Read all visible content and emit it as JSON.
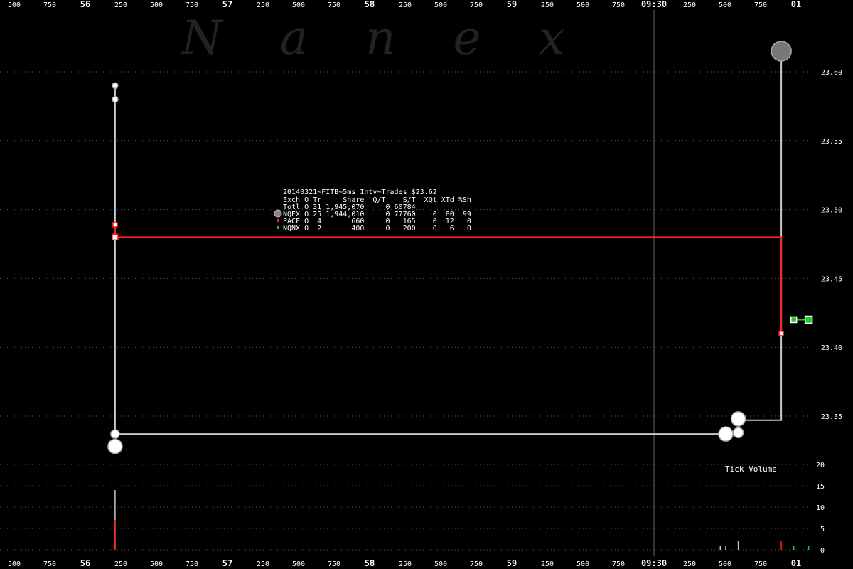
{
  "watermark": "N a n e x",
  "info_box": {
    "title": "20140321~FITB~5ms Intv~Trades $23.62",
    "header": "Exch O Tr     Share  Q/T    S/T  XQt XTd %Sh",
    "rows": [
      {
        "marker": "none",
        "text": "Totl O 31 1,945,070     0 60784"
      },
      {
        "marker": "gray",
        "text": "NQEX O 25 1,944,010     0 77760    0  80  99"
      },
      {
        "marker": "red",
        "text": "PACF O  4       660     0   165    0  12   0"
      },
      {
        "marker": "green",
        "text": "NQNX O  2       400     0   200    0   6   0"
      }
    ]
  },
  "volume_label": "Tick Volume",
  "colors": {
    "background": "#000000",
    "grid": "#5a5a5a",
    "nqex": "#c8c8c8",
    "pacf": "#ff2020",
    "nqnx": "#22cc22",
    "axis_text": "#ffffff"
  },
  "chart_data": {
    "type": "scatter",
    "x_tick_labels": [
      "500",
      "750",
      "56",
      "250",
      "500",
      "750",
      "57",
      "250",
      "500",
      "750",
      "58",
      "250",
      "500",
      "750",
      "59",
      "250",
      "500",
      "750",
      "09:30",
      "250",
      "500",
      "750",
      "01"
    ],
    "bold_x_labels": [
      "56",
      "57",
      "58",
      "59",
      "09:30",
      "01"
    ],
    "y_labels": [
      "23.60",
      "23.55",
      "23.50",
      "23.45",
      "23.40",
      "23.35"
    ],
    "y_values": [
      23.6,
      23.55,
      23.5,
      23.45,
      23.4,
      23.35
    ],
    "ylim": [
      23.315,
      23.625
    ],
    "volume_labels": [
      "20",
      "15",
      "10",
      "5",
      "0"
    ],
    "volume_values": [
      20,
      15,
      10,
      5,
      0
    ],
    "volume_ylim": [
      0,
      20
    ],
    "series": [
      {
        "name": "NQEX",
        "color": "#c8c8c8",
        "line": [
          [
            0.129,
            23.59
          ],
          [
            0.129,
            23.337
          ],
          [
            0.926,
            23.337
          ],
          [
            0.926,
            23.347
          ],
          [
            0.981,
            23.347
          ],
          [
            0.981,
            23.615
          ]
        ],
        "points": [
          {
            "x": 0.129,
            "y": 23.59,
            "r": 4
          },
          {
            "x": 0.129,
            "y": 23.58,
            "r": 4
          },
          {
            "x": 0.129,
            "y": 23.337,
            "r": 6
          },
          {
            "x": 0.129,
            "y": 23.328,
            "r": 10
          },
          {
            "x": 0.91,
            "y": 23.337,
            "r": 10
          },
          {
            "x": 0.926,
            "y": 23.338,
            "r": 7
          },
          {
            "x": 0.926,
            "y": 23.348,
            "r": 10
          },
          {
            "x": 0.981,
            "y": 23.615,
            "r": 14
          }
        ]
      },
      {
        "name": "PACF",
        "color": "#ff2020",
        "line": [
          [
            0.129,
            23.489
          ],
          [
            0.129,
            23.48
          ],
          [
            0.981,
            23.48
          ],
          [
            0.981,
            23.41
          ]
        ],
        "points": [
          {
            "x": 0.129,
            "y": 23.489,
            "r": 3
          },
          {
            "x": 0.129,
            "y": 23.48,
            "r": 4
          },
          {
            "x": 0.981,
            "y": 23.41,
            "r": 3
          }
        ]
      },
      {
        "name": "NQNX",
        "color": "#22cc22",
        "line": [
          [
            0.997,
            23.42
          ],
          [
            1.016,
            23.42
          ]
        ],
        "points": [
          {
            "x": 0.997,
            "y": 23.42,
            "r": 4
          },
          {
            "x": 1.016,
            "y": 23.42,
            "r": 5
          }
        ]
      }
    ],
    "volume_bars": [
      {
        "x": 0.129,
        "value": 14,
        "color": "#c8c8c8"
      },
      {
        "x": 0.129,
        "value": 7,
        "color": "#ff2020"
      },
      {
        "x": 0.903,
        "value": 1,
        "color": "#c8c8c8"
      },
      {
        "x": 0.91,
        "value": 1,
        "color": "#c8c8c8"
      },
      {
        "x": 0.926,
        "value": 2,
        "color": "#c8c8c8"
      },
      {
        "x": 0.981,
        "value": 2,
        "color": "#ff2020"
      },
      {
        "x": 0.997,
        "value": 1,
        "color": "#22cc22"
      },
      {
        "x": 1.016,
        "value": 1,
        "color": "#22cc22"
      }
    ],
    "session_open_x": 0.898,
    "grid": true
  }
}
